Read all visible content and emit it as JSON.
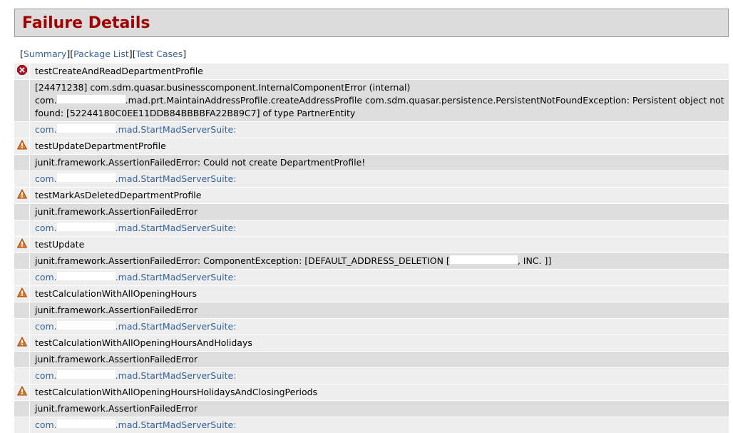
{
  "page": {
    "title": "Failure Details"
  },
  "nav": {
    "open_bracket": "[",
    "close_bracket": "]",
    "items": [
      {
        "label": "Summary"
      },
      {
        "label": "Package List"
      },
      {
        "label": "Test Cases"
      }
    ]
  },
  "colors": {
    "title_red": "#a00000",
    "banner_bg": "#dcdcdc",
    "banner_border": "#9a9a9a",
    "link_blue": "#36639c",
    "row_light": "#eeeeee",
    "row_dark": "#dddddd",
    "error_icon": "#b01020",
    "warning_icon": "#e07a2a"
  },
  "entries": [
    {
      "icon": "error-icon",
      "name": "testCreateAndReadDepartmentProfile",
      "message_prefix": "[24471238] com.sdm.quasar.businesscomponent.InternalComponentError (internal)\ncom.",
      "message_suffix": ".mad.prt.MaintainAddressProfile.createAddressProfile com.sdm.quasar.persistence.PersistentNotFoundException: Persistent object not found: [52244180C0EE11DDB84BBBBFA22B89C7] of type PartnerEntity",
      "has_redaction": true,
      "link_prefix": "com.",
      "link_suffix": ".mad.StartMadServerSuite:"
    },
    {
      "icon": "warning-icon",
      "name": "testUpdateDepartmentProfile",
      "message_prefix": "junit.framework.AssertionFailedError: Could not create DepartmentProfile!",
      "message_suffix": "",
      "has_redaction": false,
      "link_prefix": "com.",
      "link_suffix": ".mad.StartMadServerSuite:"
    },
    {
      "icon": "warning-icon",
      "name": "testMarkAsDeletedDepartmentProfile",
      "message_prefix": "junit.framework.AssertionFailedError",
      "message_suffix": "",
      "has_redaction": false,
      "link_prefix": "com.",
      "link_suffix": ".mad.StartMadServerSuite:"
    },
    {
      "icon": "warning-icon",
      "name": "testUpdate",
      "message_prefix": "junit.framework.AssertionFailedError: ComponentException: [DEFAULT_ADDRESS_DELETION [",
      "message_suffix": ", INC. ]]",
      "has_redaction": true,
      "link_prefix": "com.",
      "link_suffix": ".mad.StartMadServerSuite:"
    },
    {
      "icon": "warning-icon",
      "name": "testCalculationWithAllOpeningHours",
      "message_prefix": "junit.framework.AssertionFailedError",
      "message_suffix": "",
      "has_redaction": false,
      "link_prefix": "com.",
      "link_suffix": ".mad.StartMadServerSuite:"
    },
    {
      "icon": "warning-icon",
      "name": "testCalculationWithAllOpeningHoursAndHolidays",
      "message_prefix": "junit.framework.AssertionFailedError",
      "message_suffix": "",
      "has_redaction": false,
      "link_prefix": "com.",
      "link_suffix": ".mad.StartMadServerSuite:"
    },
    {
      "icon": "warning-icon",
      "name": "testCalculationWithAllOpeningHoursHolidaysAndClosingPeriods",
      "message_prefix": "junit.framework.AssertionFailedError",
      "message_suffix": "",
      "has_redaction": false,
      "link_prefix": "com.",
      "link_suffix": ".mad.StartMadServerSuite:"
    }
  ]
}
